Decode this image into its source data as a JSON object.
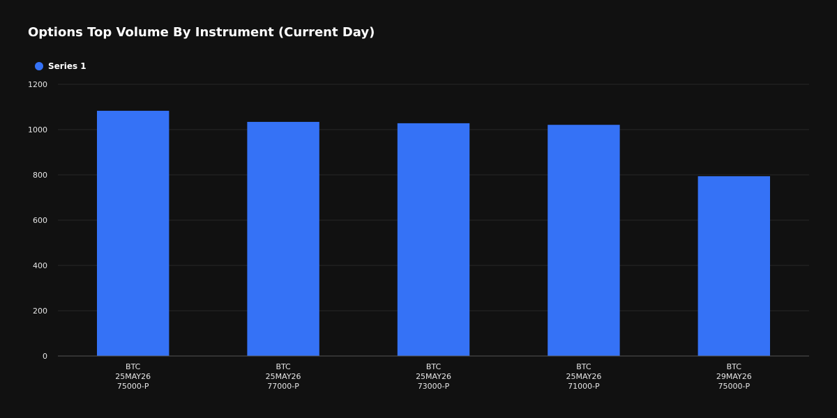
{
  "chart_data": {
    "type": "bar",
    "title": "Options Top Volume By Instrument (Current Day)",
    "categories": [
      [
        "BTC",
        "25MAY26",
        "75000-P"
      ],
      [
        "BTC",
        "25MAY26",
        "77000-P"
      ],
      [
        "BTC",
        "25MAY26",
        "73000-P"
      ],
      [
        "BTC",
        "25MAY26",
        "71000-P"
      ],
      [
        "BTC",
        "29MAY26",
        "75000-P"
      ]
    ],
    "series": [
      {
        "name": "Series 1",
        "color": "#3572f6",
        "values": [
          1083,
          1034,
          1028,
          1021,
          794
        ]
      }
    ],
    "xlabel": "",
    "ylabel": "",
    "ylim": [
      0,
      1200
    ],
    "yticks": [
      0,
      200,
      400,
      600,
      800,
      1000,
      1200
    ],
    "grid": true,
    "legend": "top-left"
  }
}
